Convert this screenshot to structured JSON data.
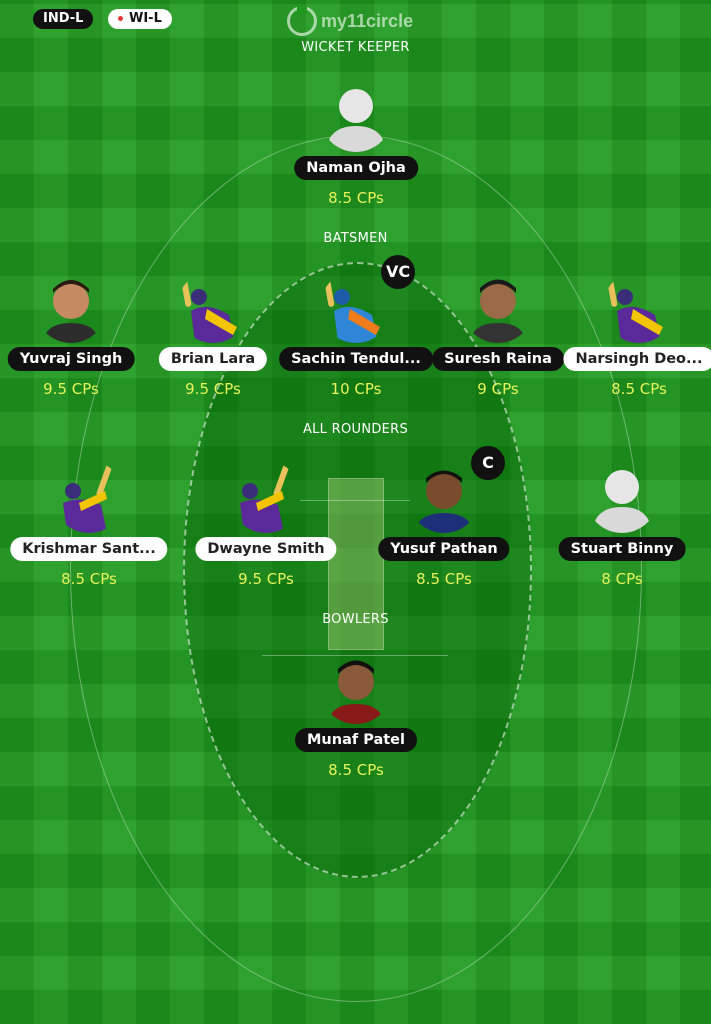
{
  "teams": {
    "team_a": "IND-L",
    "team_b": "WI-L"
  },
  "brand": {
    "logo_text": "my11circle"
  },
  "sections": {
    "wicket_keeper": "WICKET KEEPER",
    "batsmen": "BATSMEN",
    "all_rounders": "ALL ROUNDERS",
    "bowlers": "BOWLERS"
  },
  "badges": {
    "captain": "C",
    "vice_captain": "VC"
  },
  "players": {
    "wk": [
      {
        "name": "Naman Ojha",
        "cps": "8.5 CPs",
        "team": "IND-L",
        "photo": "silhouette-icon"
      }
    ],
    "batsmen": [
      {
        "name": "Yuvraj Singh",
        "cps": "9.5 CPs",
        "team": "IND-L",
        "photo": "headshot"
      },
      {
        "name": "Brian Lara",
        "cps": "9.5 CPs",
        "team": "WI-L",
        "photo": "batsman-purple"
      },
      {
        "name": "Sachin Tendul...",
        "cps": "10 CPs",
        "team": "IND-L",
        "photo": "batsman-blue"
      },
      {
        "name": "Suresh Raina",
        "cps": "9 CPs",
        "team": "IND-L",
        "photo": "headshot"
      },
      {
        "name": "Narsingh Deo...",
        "cps": "8.5 CPs",
        "team": "WI-L",
        "photo": "batsman-purple"
      }
    ],
    "all_rounders": [
      {
        "name": "Krishmar Sant...",
        "cps": "8.5 CPs",
        "team": "WI-L",
        "photo": "batsman-purple"
      },
      {
        "name": "Dwayne Smith",
        "cps": "9.5 CPs",
        "team": "WI-L",
        "photo": "batsman-purple"
      },
      {
        "name": "Yusuf Pathan",
        "cps": "8.5 CPs",
        "team": "IND-L",
        "photo": "headshot"
      },
      {
        "name": "Stuart Binny",
        "cps": "8 CPs",
        "team": "IND-L",
        "photo": "silhouette-icon"
      }
    ],
    "bowlers": [
      {
        "name": "Munaf Patel",
        "cps": "8.5 CPs",
        "team": "IND-L",
        "photo": "headshot"
      }
    ]
  },
  "colors": {
    "field": "#1f9a1f",
    "cps_text": "#e8f35a",
    "pill_dark": "#111111",
    "pill_light": "#ffffff"
  }
}
